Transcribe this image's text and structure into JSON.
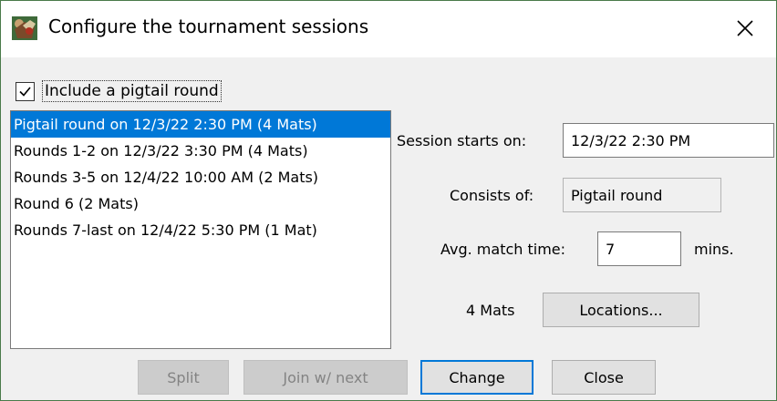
{
  "window": {
    "title": "Configure the tournament sessions",
    "app_icon": "tournament-app-icon",
    "close_icon": "close-icon"
  },
  "pigtail": {
    "label": "Include a pigtail round",
    "checked": true
  },
  "sessions": [
    {
      "label": "Pigtail round on 12/3/22 2:30 PM (4 Mats)",
      "selected": true
    },
    {
      "label": "Rounds 1-2 on 12/3/22 3:30 PM (4 Mats)",
      "selected": false
    },
    {
      "label": "Rounds 3-5 on 12/4/22 10:00 AM (2 Mats)",
      "selected": false
    },
    {
      "label": "Round 6 (2 Mats)",
      "selected": false
    },
    {
      "label": "Rounds 7-last on 12/4/22 5:30 PM (1 Mat)",
      "selected": false
    }
  ],
  "details": {
    "starts_label": "Session starts on:",
    "starts_value": "12/3/22 2:30 PM",
    "consists_label": "Consists of:",
    "consists_value": "Pigtail round",
    "avg_label": "Avg. match time:",
    "avg_value": "7",
    "avg_unit": "mins.",
    "mats_label": "4 Mats",
    "locations_button": "Locations..."
  },
  "buttons": {
    "split": "Split",
    "join": "Join w/ next",
    "change": "Change",
    "close": "Close"
  },
  "colors": {
    "selection": "#0078d7",
    "window_border": "#4a7a4a",
    "dialog_bg": "#f0f0f0"
  }
}
